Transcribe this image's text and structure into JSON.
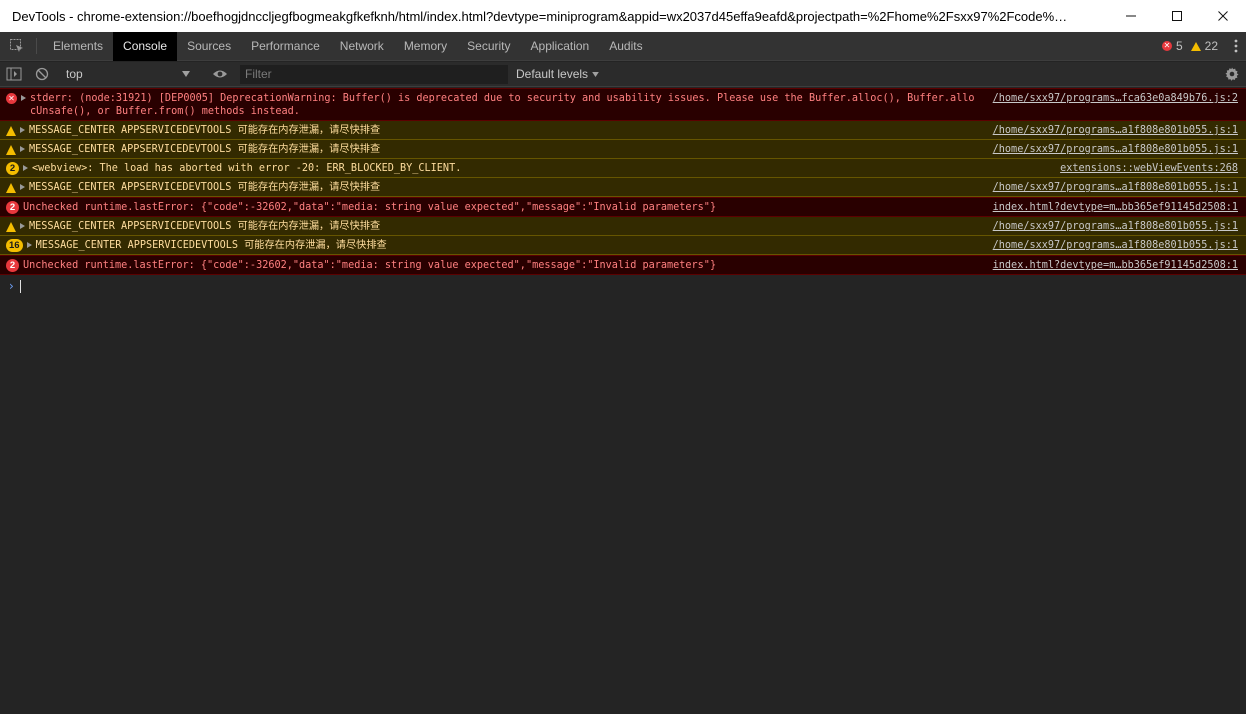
{
  "window": {
    "title": "DevTools - chrome-extension://boefhogjdnccljegfbogmeakgfkefknh/html/index.html?devtype=miniprogram&appid=wx2037d45effa9eafd&projectpath=%2Fhome%2Fsxx97%2Fcode%…",
    "minimize": "—",
    "maximize": "☐",
    "close": "✕"
  },
  "tabs": [
    {
      "label": "Elements",
      "active": false
    },
    {
      "label": "Console",
      "active": true
    },
    {
      "label": "Sources",
      "active": false
    },
    {
      "label": "Performance",
      "active": false
    },
    {
      "label": "Network",
      "active": false
    },
    {
      "label": "Memory",
      "active": false
    },
    {
      "label": "Security",
      "active": false
    },
    {
      "label": "Application",
      "active": false
    },
    {
      "label": "Audits",
      "active": false
    }
  ],
  "counters": {
    "errors": "5",
    "warnings": "22"
  },
  "toolbar": {
    "context": "top",
    "filter_placeholder": "Filter",
    "levels": "Default levels"
  },
  "messages": [
    {
      "level": "error",
      "icon": "error-icon",
      "count": "",
      "expandable": true,
      "text": "stderr: (node:31921) [DEP0005] DeprecationWarning: Buffer() is deprecated due to security and usability issues. Please use the Buffer.alloc(), Buffer.allocUnsafe(), or Buffer.from() methods instead.",
      "source": "/home/sxx97/programs…fca63e0a849b76.js:2"
    },
    {
      "level": "warning",
      "icon": "warning-icon",
      "count": "",
      "expandable": true,
      "text": "MESSAGE_CENTER APPSERVICEDEVTOOLS 可能存在内存泄漏，请尽快排查",
      "source": "/home/sxx97/programs…a1f808e801b055.js:1"
    },
    {
      "level": "warning",
      "icon": "warning-icon",
      "count": "",
      "expandable": true,
      "text": "MESSAGE_CENTER APPSERVICEDEVTOOLS 可能存在内存泄漏，请尽快排查",
      "source": "/home/sxx97/programs…a1f808e801b055.js:1"
    },
    {
      "level": "warning",
      "icon": "count-badge",
      "count": "2",
      "expandable": true,
      "text": "<webview>: The load has aborted with error -20: ERR_BLOCKED_BY_CLIENT.",
      "source": "extensions::webViewEvents:268"
    },
    {
      "level": "warning",
      "icon": "warning-icon",
      "count": "",
      "expandable": true,
      "text": "MESSAGE_CENTER APPSERVICEDEVTOOLS 可能存在内存泄漏，请尽快排查",
      "source": "/home/sxx97/programs…a1f808e801b055.js:1"
    },
    {
      "level": "error",
      "icon": "count-badge",
      "count": "2",
      "expandable": false,
      "text": "Unchecked runtime.lastError: {\"code\":-32602,\"data\":\"media: string value expected\",\"message\":\"Invalid parameters\"}",
      "source": "index.html?devtype=m…bb365ef91145d2508:1"
    },
    {
      "level": "warning",
      "icon": "warning-icon",
      "count": "",
      "expandable": true,
      "text": "MESSAGE_CENTER APPSERVICEDEVTOOLS 可能存在内存泄漏，请尽快排查",
      "source": "/home/sxx97/programs…a1f808e801b055.js:1"
    },
    {
      "level": "warning",
      "icon": "count-badge",
      "count": "16",
      "expandable": true,
      "text": "MESSAGE_CENTER APPSERVICEDEVTOOLS 可能存在内存泄漏，请尽快排查",
      "source": "/home/sxx97/programs…a1f808e801b055.js:1"
    },
    {
      "level": "error",
      "icon": "count-badge",
      "count": "2",
      "expandable": false,
      "text": "Unchecked runtime.lastError: {\"code\":-32602,\"data\":\"media: string value expected\",\"message\":\"Invalid parameters\"}",
      "source": "index.html?devtype=m…bb365ef91145d2508:1"
    }
  ],
  "prompt": {
    "symbol": "›"
  },
  "colors": {
    "error_bg": "#290000",
    "error_text": "#ff8080",
    "warning_bg": "#332a00",
    "warning_text": "#ffdd9e",
    "accent": "#6e9ef5"
  }
}
